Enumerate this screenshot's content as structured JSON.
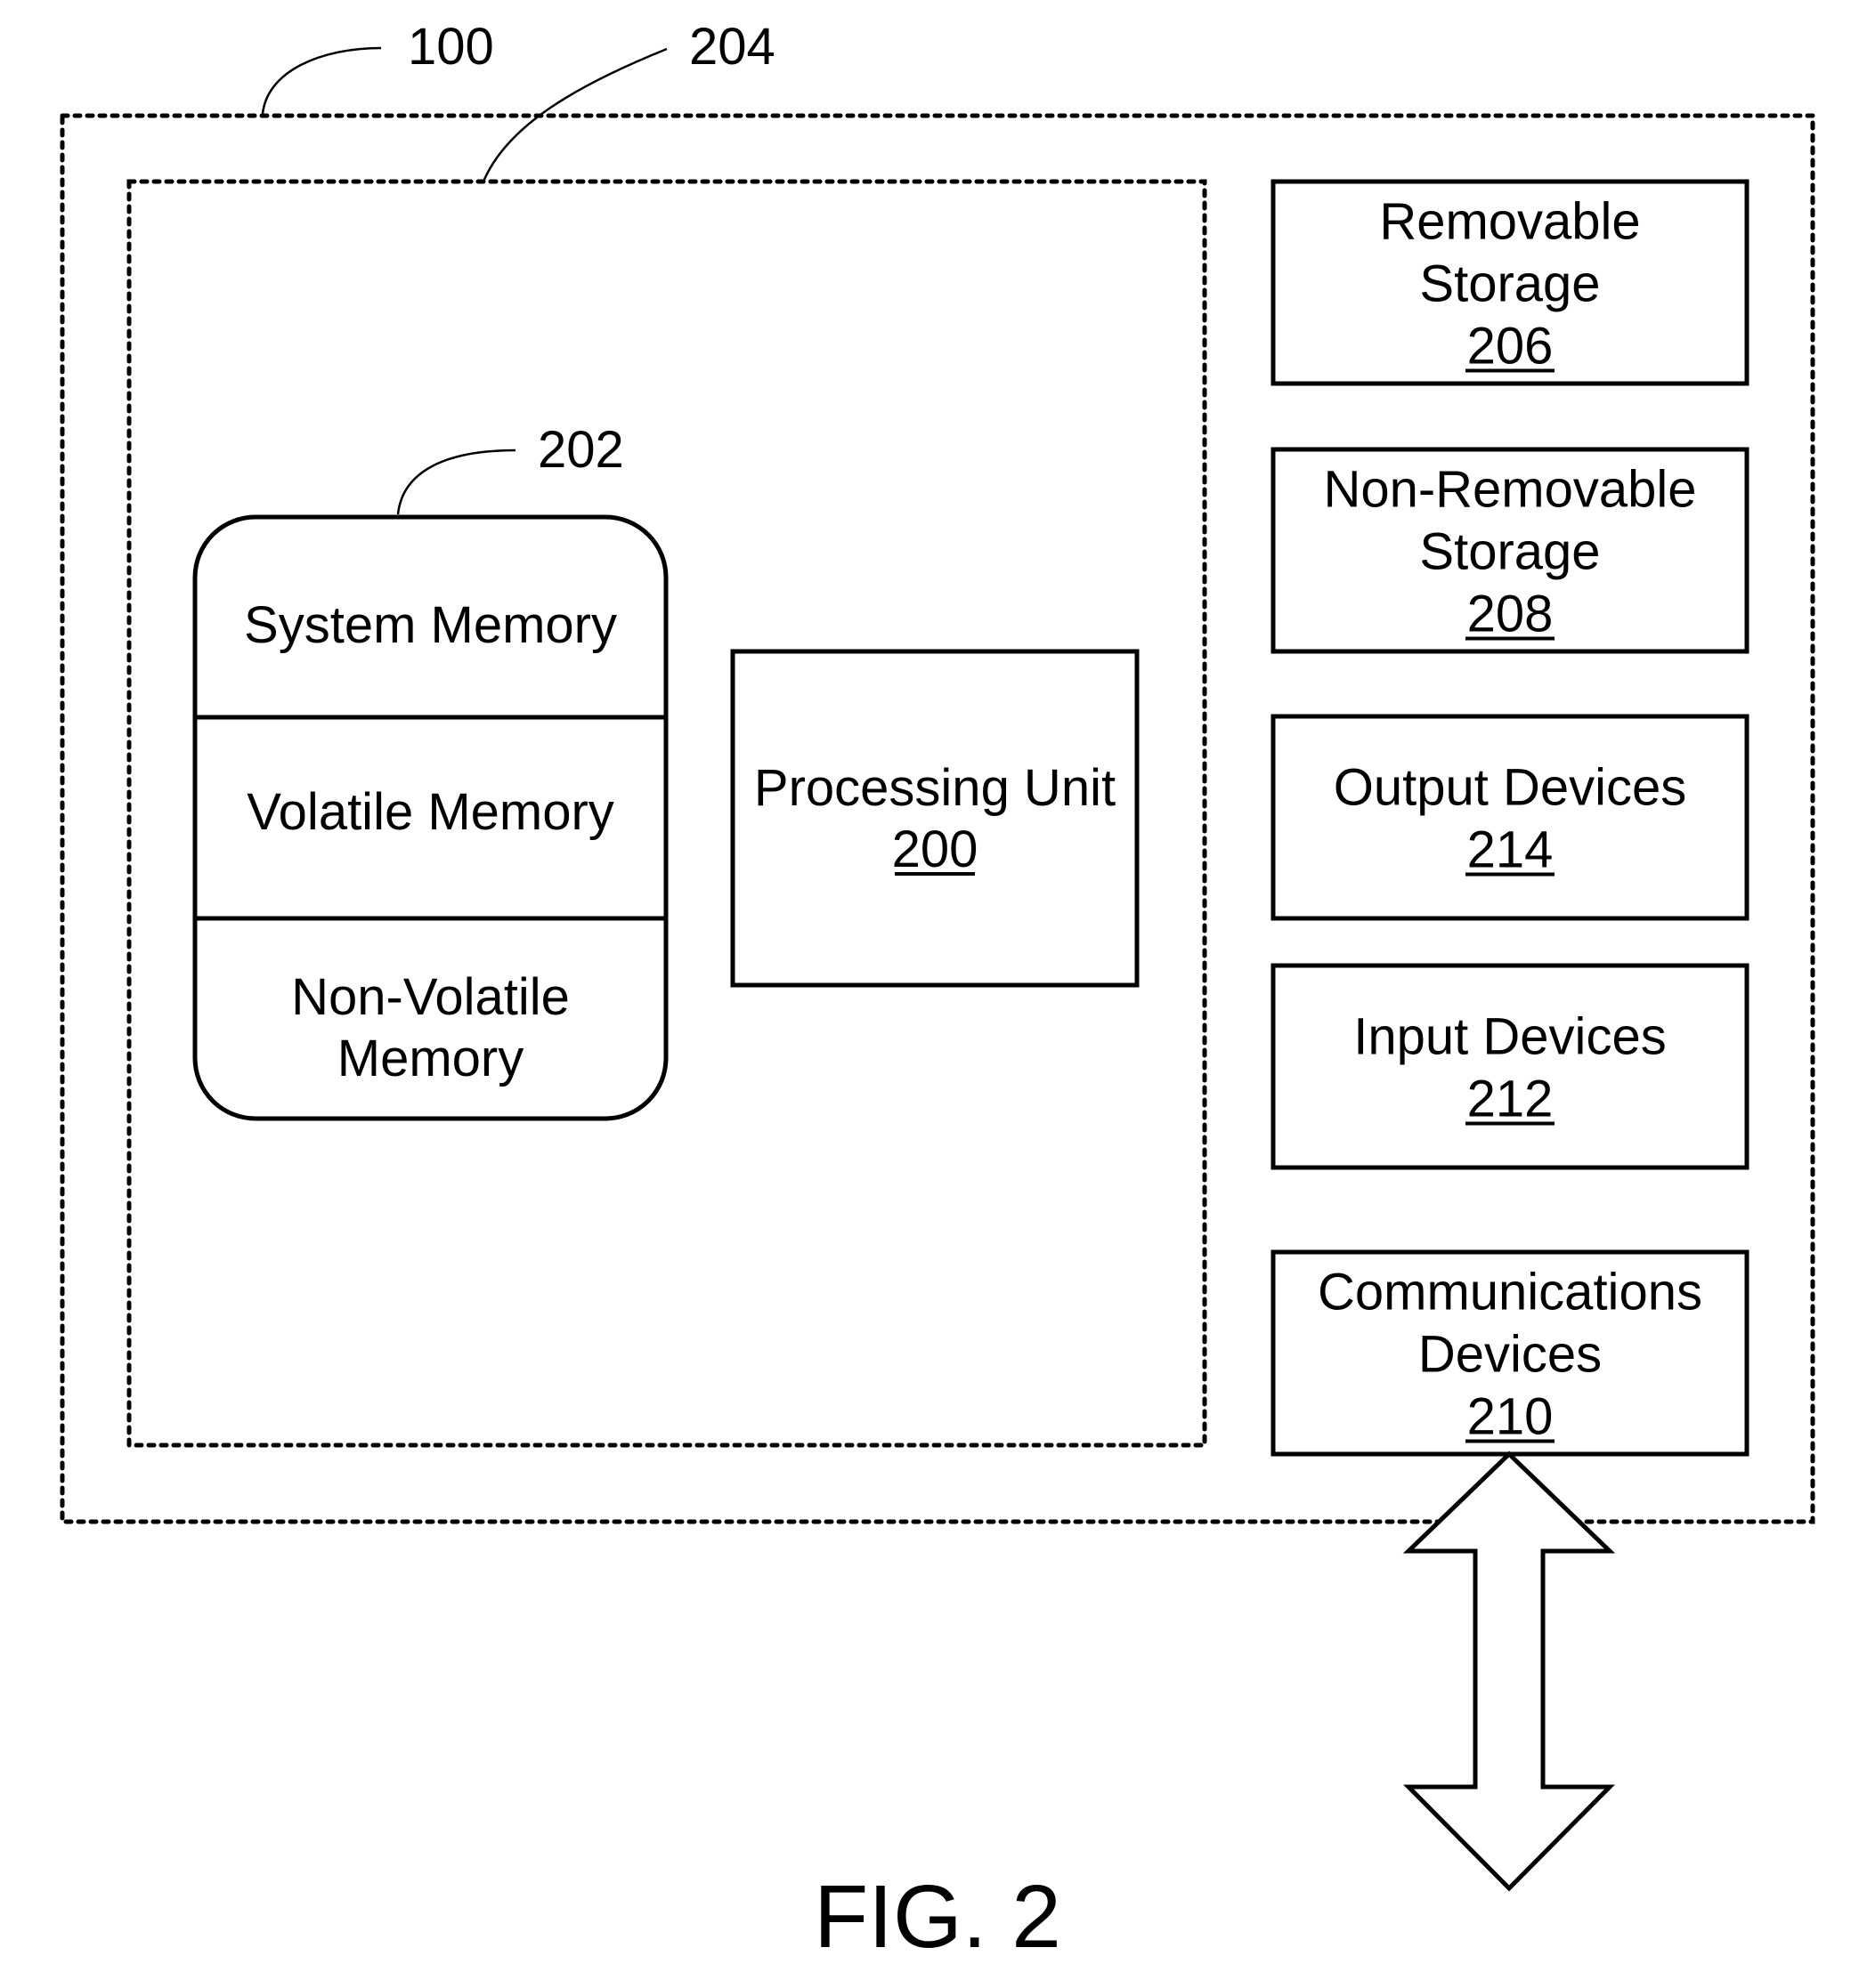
{
  "figure": {
    "caption": "FIG. 2",
    "reference_labels": {
      "device": "100",
      "basic_config": "204",
      "memory": "202"
    }
  },
  "memory_stack": {
    "sections": [
      {
        "label": "System Memory"
      },
      {
        "label": "Volatile Memory"
      },
      {
        "label_lines": [
          "Non-Volatile",
          "Memory"
        ]
      }
    ]
  },
  "processing_unit": {
    "label": "Processing Unit",
    "ref": "200"
  },
  "components": [
    {
      "key": "removable-storage",
      "label_lines": [
        "Removable",
        "Storage"
      ],
      "ref": "206"
    },
    {
      "key": "non-removable-storage",
      "label_lines": [
        "Non-Removable",
        "Storage"
      ],
      "ref": "208"
    },
    {
      "key": "output-devices",
      "label_lines": [
        "Output Devices"
      ],
      "ref": "214"
    },
    {
      "key": "input-devices",
      "label_lines": [
        "Input Devices"
      ],
      "ref": "212"
    },
    {
      "key": "communications-devices",
      "label_lines": [
        "Communications",
        "Devices"
      ],
      "ref": "210"
    }
  ],
  "connection": {
    "type": "bidirectional-arrow",
    "from": "communications-devices",
    "to": "external-network"
  }
}
